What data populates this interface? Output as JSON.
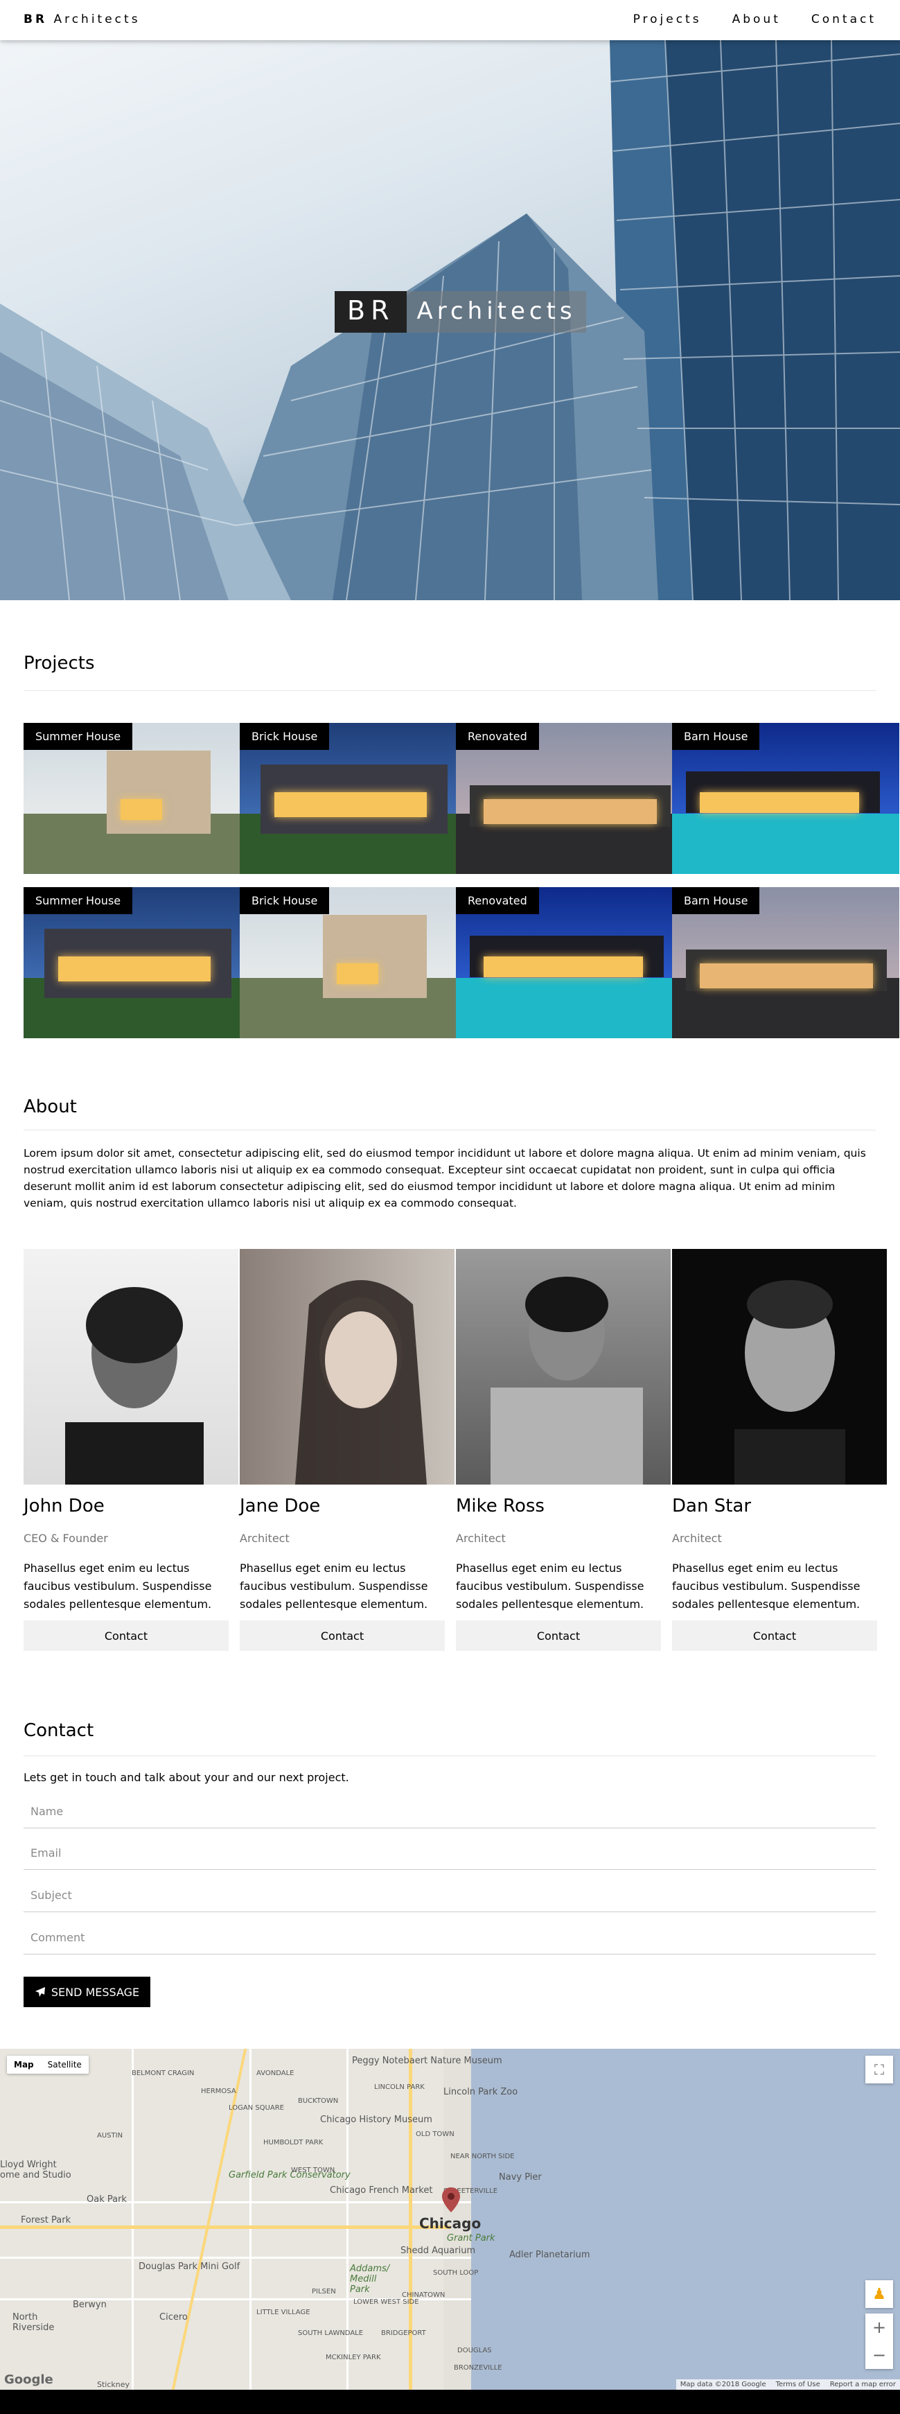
{
  "nav": {
    "brand_bold": "BR",
    "brand_rest": "Architects",
    "links": [
      "Projects",
      "About",
      "Contact"
    ]
  },
  "hero": {
    "title_box": "BR",
    "title_rest": "Architects"
  },
  "projects": {
    "heading": "Projects",
    "row1": [
      "Summer House",
      "Brick House",
      "Renovated",
      "Barn House"
    ],
    "row2": [
      "Summer House",
      "Brick House",
      "Renovated",
      "Barn House"
    ]
  },
  "about": {
    "heading": "About",
    "text": "Lorem ipsum dolor sit amet, consectetur adipiscing elit, sed do eiusmod tempor incididunt ut labore et dolore magna aliqua. Ut enim ad minim veniam, quis nostrud exercitation ullamco laboris nisi ut aliquip ex ea commodo consequat. Excepteur sint occaecat cupidatat non proident, sunt in culpa qui officia deserunt mollit anim id est laborum consectetur adipiscing elit, sed do eiusmod tempor incididunt ut labore et dolore magna aliqua. Ut enim ad minim veniam, quis nostrud exercitation ullamco laboris nisi ut aliquip ex ea commodo consequat.",
    "team": [
      {
        "name": "John Doe",
        "role": "CEO & Founder",
        "desc": "Phasellus eget enim eu lectus faucibus vestibulum. Suspendisse sodales pellentesque elementum.",
        "button": "Contact"
      },
      {
        "name": "Jane Doe",
        "role": "Architect",
        "desc": "Phasellus eget enim eu lectus faucibus vestibulum. Suspendisse sodales pellentesque elementum.",
        "button": "Contact"
      },
      {
        "name": "Mike Ross",
        "role": "Architect",
        "desc": "Phasellus eget enim eu lectus faucibus vestibulum. Suspendisse sodales pellentesque elementum.",
        "button": "Contact"
      },
      {
        "name": "Dan Star",
        "role": "Architect",
        "desc": "Phasellus eget enim eu lectus faucibus vestibulum. Suspendisse sodales pellentesque elementum.",
        "button": "Contact"
      }
    ]
  },
  "contact": {
    "heading": "Contact",
    "intro": "Lets get in touch and talk about your and our next project.",
    "placeholders": {
      "name": "Name",
      "email": "Email",
      "subject": "Subject",
      "comment": "Comment"
    },
    "send_label": "SEND MESSAGE",
    "send_icon": "paper-plane-icon"
  },
  "map": {
    "toggle_map": "Map",
    "toggle_satellite": "Satellite",
    "city": "Chicago",
    "labels": {
      "peggy": "Peggy Notebaert Nature Museum",
      "lincoln_zoo": "Lincoln Park Zoo",
      "lincoln_park": "LINCOLN PARK",
      "history": "Chicago History Museum",
      "old_town": "OLD TOWN",
      "humboldt": "HUMBOLDT PARK",
      "garfield": "Garfield Park Conservatory",
      "french_market": "Chicago French Market",
      "navy_pier": "Navy Pier",
      "west_town": "WEST TOWN",
      "oak_park": "Oak Park",
      "forest_park": "Forest Park",
      "grant_park": "Grant Park",
      "shedd": "Shedd Aquarium",
      "adler": "Adler Planetarium",
      "douglas_golf": "Douglas Park Mini Golf",
      "addams": "Addams/ Medill Park",
      "cicero": "Cicero",
      "berwyn": "Berwyn",
      "north_riverside": "North Riverside",
      "lloyd": "Lloyd Wright ome and Studio",
      "little_village": "LITTLE VILLAGE",
      "bridgeport": "BRIDGEPORT",
      "south_loop": "SOUTH LOOP",
      "logan_square": "LOGAN SQUARE",
      "bucktown": "BUCKTOWN",
      "hermosa": "HERMOSA",
      "avondale": "AVONDALE",
      "belmont_cragin": "BELMONT CRAGIN",
      "austin": "AUSTIN",
      "near_north": "NEAR NORTH SIDE",
      "streeterville": "STREETERVILLE",
      "pilsen": "PILSEN",
      "chinatown": "CHINATOWN",
      "mckinley": "MCKINLEY PARK",
      "douglas": "DOUGLAS",
      "bronzeville": "BRONZEVILLE",
      "lawndale": "SOUTH LAWNDALE",
      "lower_west": "LOWER WEST SIDE",
      "stickney": "Stickney"
    },
    "footer": [
      "Map data ©2018 Google",
      "Terms of Use",
      "Report a map error"
    ],
    "google": "Google"
  },
  "colors": {
    "accent": "#000000",
    "button_bg": "#f1f1f1",
    "muted_text": "#757575"
  }
}
